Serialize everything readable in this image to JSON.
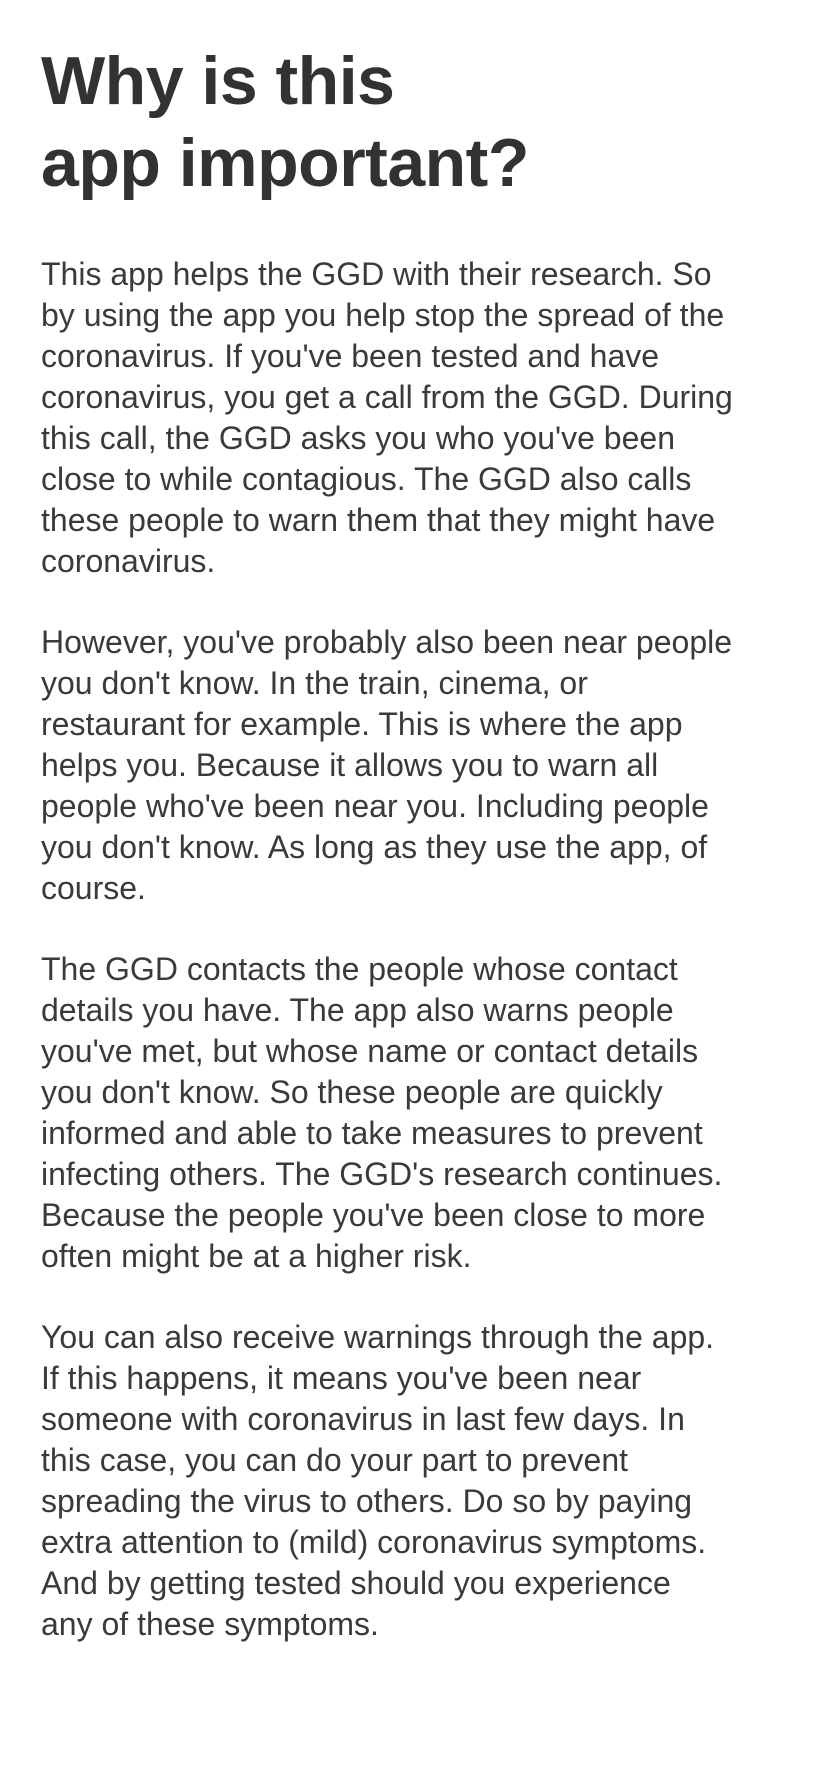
{
  "title": {
    "lines": [
      "Why is this",
      "app important?"
    ]
  },
  "paragraphs": [
    {
      "lines": [
        "This app helps the GGD with their research. So",
        "by using the app you help stop the spread of the",
        "coronavirus. If you've been tested and have",
        "coronavirus, you get a call from the GGD. During",
        "this call, the GGD asks you who you've been",
        "close to while contagious. The GGD also calls",
        "these people to warn them that they might have",
        "coronavirus."
      ]
    },
    {
      "lines": [
        "However, you've probably also been near people",
        "you don't know. In the train, cinema, or",
        "restaurant for example. This is where the app",
        "helps you. Because it allows you to warn all",
        "people who've been near you. Including people",
        "you don't know. As long as they use the app, of",
        "course."
      ]
    },
    {
      "lines": [
        "The GGD contacts the people whose contact",
        "details you have. The app also warns people",
        "you've met, but whose name or contact details",
        "you don't know. So these people are quickly",
        "informed and able to take measures to prevent",
        "infecting others. The GGD's research continues.",
        "Because the people you've been close to more",
        "often might be at a higher risk."
      ]
    },
    {
      "lines": [
        "You can also receive warnings through the app.",
        "If this happens, it means you've been near",
        "someone with coronavirus in last few days. In",
        "this case, you can do your part to prevent",
        "spreading the virus to others. Do so by paying",
        "extra attention to (mild) coronavirus symptoms.",
        "And by getting tested should you experience",
        "any of these symptoms."
      ]
    }
  ]
}
